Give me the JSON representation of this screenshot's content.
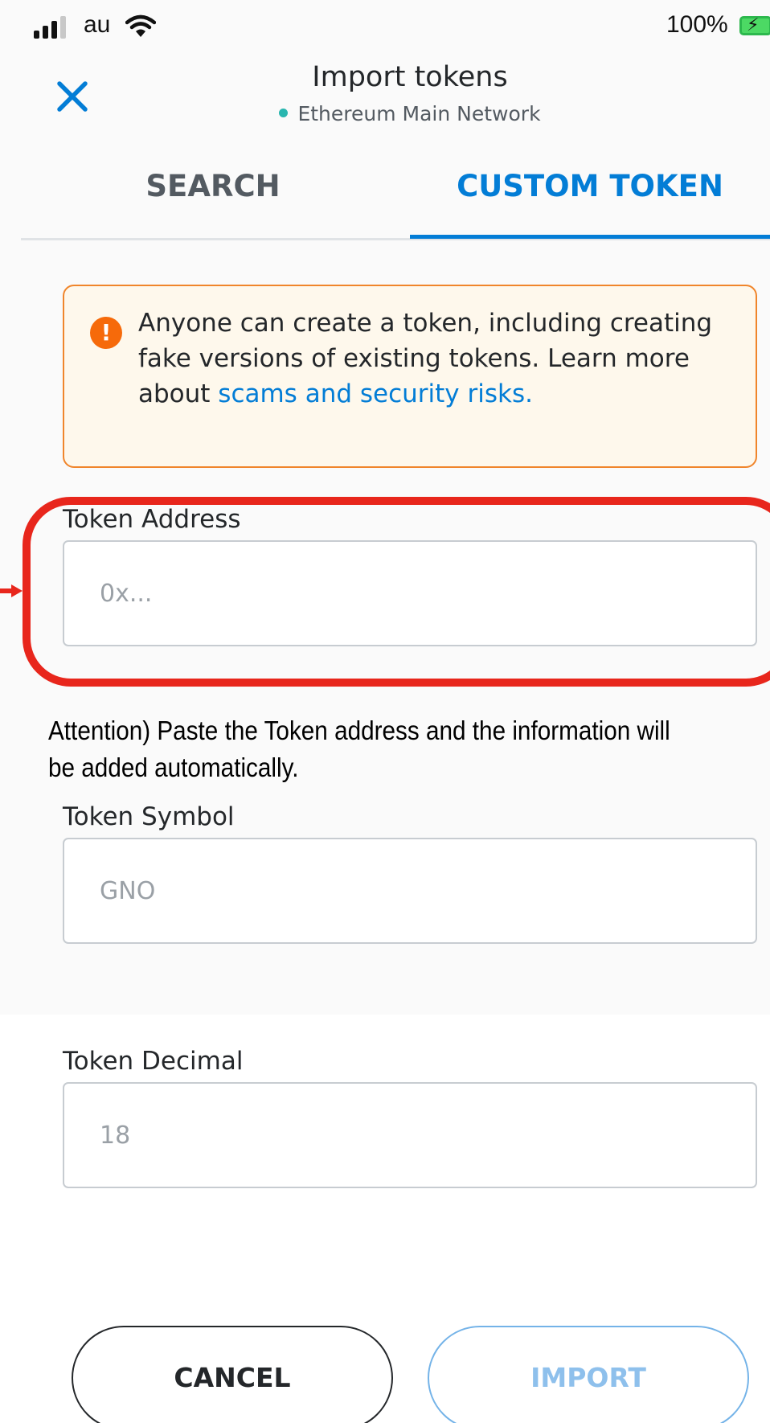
{
  "status_bar": {
    "carrier": "au",
    "battery": "100%",
    "icons": [
      "signal-icon",
      "wifi-icon",
      "battery-charging-icon"
    ]
  },
  "header": {
    "title": "Import tokens",
    "network": "Ethereum Main Network",
    "close_icon": "close-icon"
  },
  "tabs": [
    {
      "label": "SEARCH",
      "active": false
    },
    {
      "label": "CUSTOM TOKEN",
      "active": true
    }
  ],
  "warning": {
    "icon": "exclamation-icon",
    "text": "Anyone can create a token, including creating fake versions of existing tokens. Learn more about ",
    "link": "scams and security risks."
  },
  "fields": {
    "address": {
      "label": "Token Address",
      "placeholder": "0x...",
      "value": ""
    },
    "symbol": {
      "label": "Token Symbol",
      "placeholder": "GNO",
      "value": ""
    },
    "decimal": {
      "label": "Token Decimal",
      "placeholder": "18",
      "value": ""
    }
  },
  "annotation": {
    "note": "Attention) Paste the Token address and the information will be added automatically."
  },
  "buttons": {
    "cancel": "CANCEL",
    "import": "IMPORT"
  },
  "colors": {
    "accent": "#037dd6",
    "warning_border": "#f0852b",
    "warning_bg": "#fef8ec",
    "highlight_frame": "#e8261c"
  }
}
